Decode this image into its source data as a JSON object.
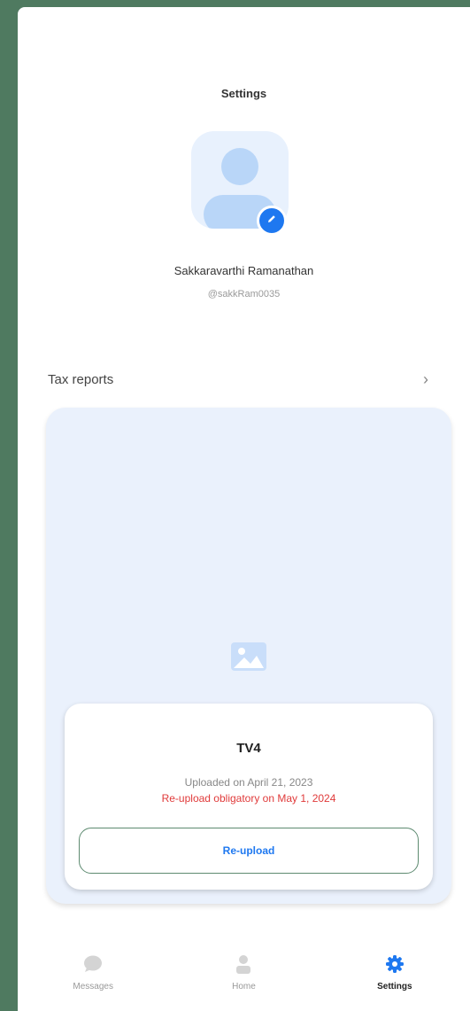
{
  "header": {
    "title": "Settings"
  },
  "profile": {
    "name": "Sakkaravarthi Ramanathan",
    "handle": "@sakkRam0035",
    "avatar_icon": "person-icon",
    "edit_icon": "pencil-icon"
  },
  "tax_reports": {
    "label": "Tax reports",
    "chevron": "›"
  },
  "document": {
    "preview_icon": "image-icon",
    "title": "TV4",
    "uploaded": "Uploaded on April 21, 2023",
    "warning": "Re-upload obligatory on May 1, 2024",
    "button_label": "Re-upload"
  },
  "nav": {
    "items": [
      {
        "label": "Messages",
        "icon": "chat-bubble-icon",
        "active": false
      },
      {
        "label": "Home",
        "icon": "person-icon",
        "active": false
      },
      {
        "label": "Settings",
        "icon": "gear-icon",
        "active": true
      }
    ]
  },
  "colors": {
    "accent": "#1e78f0",
    "warning": "#e03a3a",
    "card_bg": "#eaf1fc",
    "button_border": "#5d8a70",
    "backdrop": "#4f7a60"
  }
}
